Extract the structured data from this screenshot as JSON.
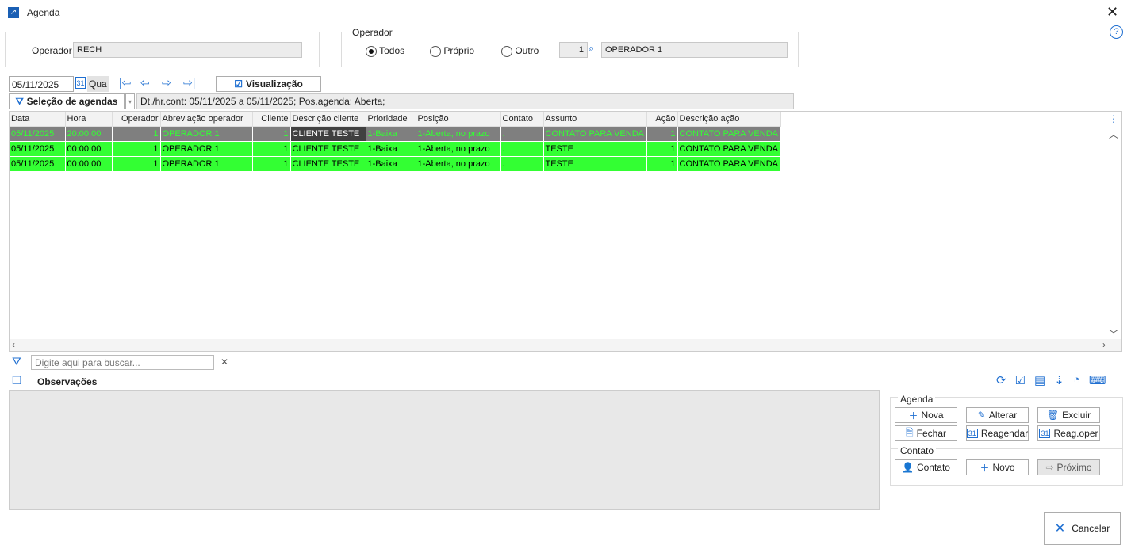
{
  "window": {
    "title": "Agenda"
  },
  "operator": {
    "label": "Operador",
    "value": "RECH"
  },
  "operator_filter": {
    "legend": "Operador",
    "options": [
      "Todos",
      "Próprio",
      "Outro"
    ],
    "selected": "Todos",
    "code": "1",
    "name": "OPERADOR 1"
  },
  "nav": {
    "date": "05/11/2025",
    "weekday": "Qua",
    "view_label": "Visualização"
  },
  "selection": {
    "label": "Seleção de agendas",
    "summary": "Dt./hr.cont: 05/11/2025 a 05/11/2025; Pos.agenda: Aberta;"
  },
  "grid": {
    "columns": [
      {
        "label": "Data",
        "w": 70
      },
      {
        "label": "Hora",
        "w": 59
      },
      {
        "label": "Operador",
        "w": 61,
        "align": "r"
      },
      {
        "label": "Abreviação operador",
        "w": 116
      },
      {
        "label": "Cliente",
        "w": 48,
        "align": "r"
      },
      {
        "label": "Descrição cliente",
        "w": 95
      },
      {
        "label": "Prioridade",
        "w": 63
      },
      {
        "label": "Posição",
        "w": 107
      },
      {
        "label": "Contato",
        "w": 54
      },
      {
        "label": "Assunto",
        "w": 130
      },
      {
        "label": "Ação",
        "w": 39,
        "align": "r"
      },
      {
        "label": "Descrição ação",
        "w": 130
      }
    ],
    "rows": [
      [
        "05/11/2025",
        "20:00:00",
        "1",
        "OPERADOR 1",
        "1",
        "CLIENTE TESTE",
        "1-Baixa",
        "1-Aberta, no prazo",
        ".",
        "CONTATO PARA VENDA",
        "1",
        "CONTATO PARA VENDA"
      ],
      [
        "05/11/2025",
        "00:00:00",
        "1",
        "OPERADOR 1",
        "1",
        "CLIENTE TESTE",
        "1-Baixa",
        "1-Aberta, no prazo",
        ".",
        "TESTE",
        "1",
        "CONTATO PARA VENDA"
      ],
      [
        "05/11/2025",
        "00:00:00",
        "1",
        "OPERADOR 1",
        "1",
        "CLIENTE TESTE",
        "1-Baixa",
        "1-Aberta, no prazo",
        ".",
        "TESTE",
        "1",
        "CONTATO PARA VENDA"
      ]
    ],
    "selected_row": 0
  },
  "search": {
    "placeholder": "Digite aqui para buscar..."
  },
  "obs": {
    "label": "Observações"
  },
  "agenda": {
    "legend": "Agenda",
    "nova": "Nova",
    "alterar": "Alterar",
    "excluir": "Excluir",
    "fechar": "Fechar",
    "reagendar": "Reagendar",
    "reagoper": "Reag.oper"
  },
  "contato": {
    "legend": "Contato",
    "contato": "Contato",
    "novo": "Novo",
    "proximo": "Próximo"
  },
  "cancel": "Cancelar",
  "colors": {
    "row_green": "#33ff33",
    "row_selected": "#7f7f7f",
    "accent": "#1f6fd1"
  }
}
